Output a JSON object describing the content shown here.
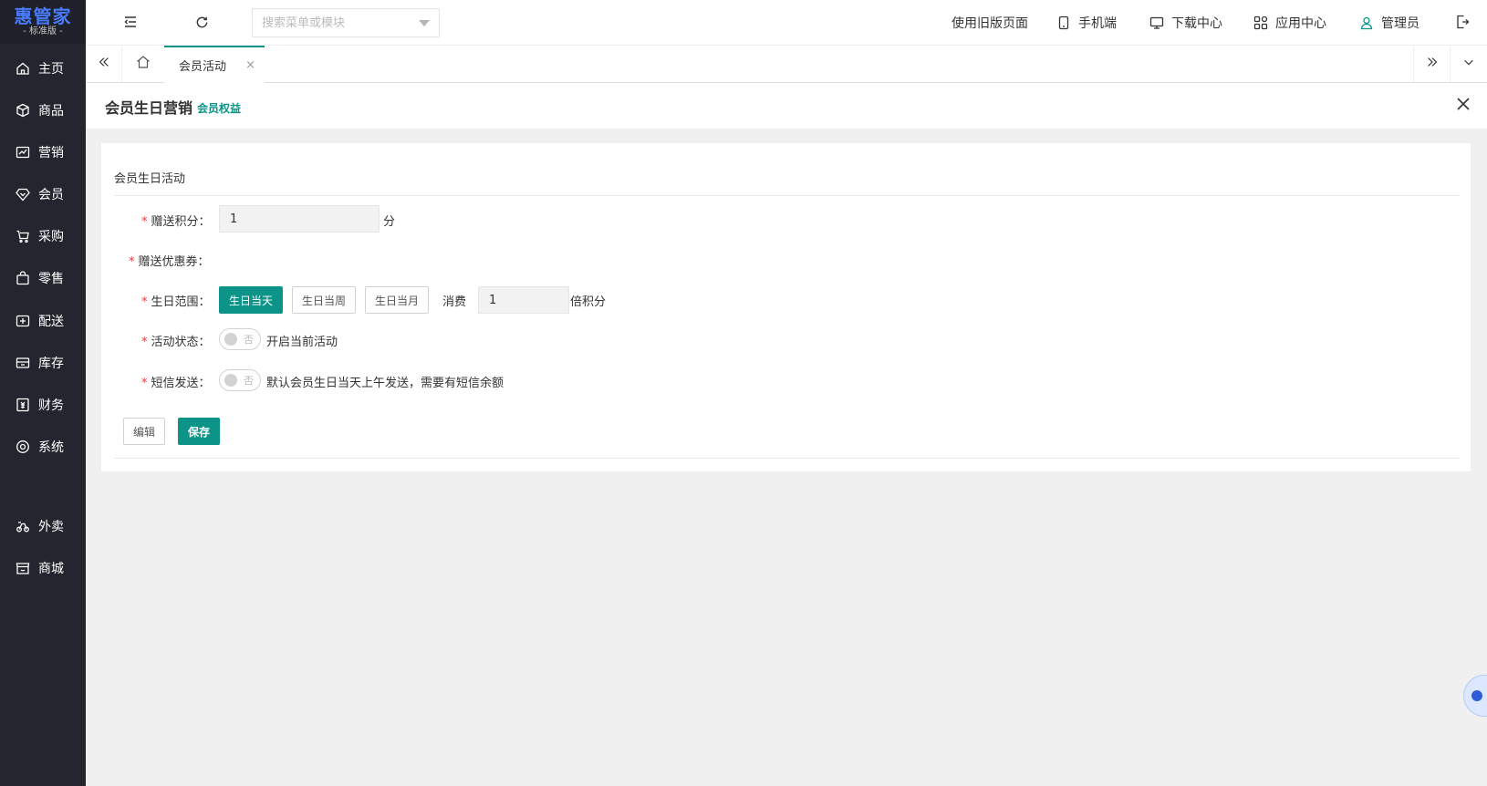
{
  "brand": {
    "name": "惠管家",
    "edition": "- 标准版 -",
    "color": "#4a7bff"
  },
  "theme": {
    "accent": "#0d9488",
    "sidebar_bg": "#23262e",
    "required": "#e4393c"
  },
  "sidebar": {
    "items": [
      {
        "label": "主页",
        "icon": "home-icon"
      },
      {
        "label": "商品",
        "icon": "box-icon"
      },
      {
        "label": "营销",
        "icon": "chart-icon"
      },
      {
        "label": "会员",
        "icon": "diamond-icon"
      },
      {
        "label": "采购",
        "icon": "cart-icon"
      },
      {
        "label": "零售",
        "icon": "bag-icon"
      },
      {
        "label": "配送",
        "icon": "delivery-icon"
      },
      {
        "label": "库存",
        "icon": "inventory-icon"
      },
      {
        "label": "财务",
        "icon": "finance-icon"
      },
      {
        "label": "系统",
        "icon": "settings-icon"
      },
      {
        "label": "外卖",
        "icon": "takeout-icon"
      },
      {
        "label": "商城",
        "icon": "mall-icon"
      }
    ]
  },
  "header": {
    "search_placeholder": "搜索菜单或模块",
    "links": [
      {
        "label": "使用旧版页面"
      },
      {
        "label": "手机端",
        "icon": "mobile-icon"
      },
      {
        "label": "下载中心",
        "icon": "monitor-icon"
      },
      {
        "label": "应用中心",
        "icon": "apps-icon"
      },
      {
        "label": "管理员",
        "icon": "user-icon"
      }
    ]
  },
  "tabs": {
    "active_label": "会员活动",
    "close_glyph": "×"
  },
  "page": {
    "title": "会员生日营销",
    "subtitle": "会员权益"
  },
  "form": {
    "section_title": "会员生日活动",
    "points": {
      "label": "赠送积分：",
      "value": "1",
      "unit": "分"
    },
    "coupon": {
      "label": "赠送优惠券："
    },
    "range": {
      "label": "生日范围：",
      "options": [
        "生日当天",
        "生日当周",
        "生日当月"
      ],
      "selected": "生日当天",
      "consume_label": "消费",
      "multiplier": "1",
      "multiplier_unit": "倍积分"
    },
    "status": {
      "label": "活动状态：",
      "switch_text": "否",
      "description": "开启当前活动"
    },
    "sms": {
      "label": "短信发送：",
      "switch_text": "否",
      "description": "默认会员生日当天上午发送，需要有短信余额"
    },
    "required_mark": "*",
    "edit_label": "编辑",
    "save_label": "保存"
  }
}
